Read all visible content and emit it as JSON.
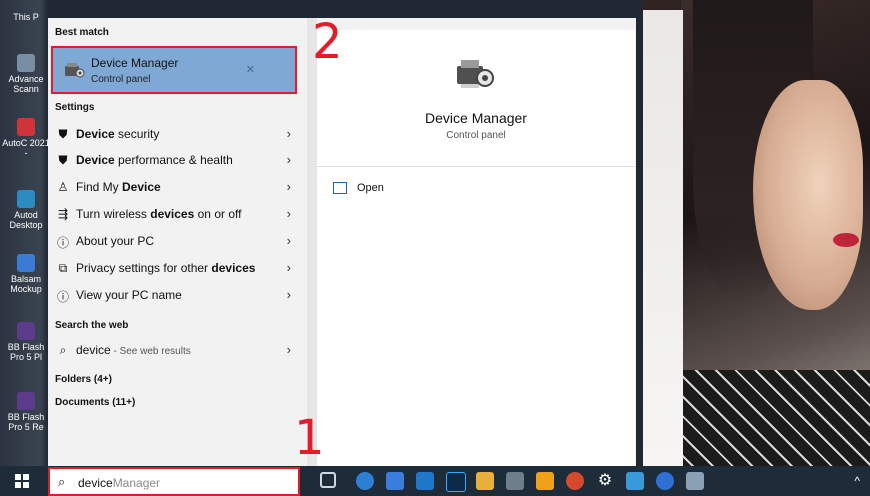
{
  "desktop": {
    "icons": [
      {
        "label": "This P",
        "color": "#4a7fb5"
      },
      {
        "label": "Advance Scann",
        "color": "#7a8ea3"
      },
      {
        "label": "AutoC 2021 -",
        "color": "#d13438"
      },
      {
        "label": "Autod Desktop",
        "color": "#2b8cc4"
      },
      {
        "label": "Balsam Mockup",
        "color": "#3a7bd5"
      },
      {
        "label": "BB Flash Pro 5 Pl",
        "color": "#5c3b8c"
      },
      {
        "label": "BB Flash Pro 5 Re",
        "color": "#5c3b8c"
      }
    ]
  },
  "start_menu": {
    "best_match_title": "Best match",
    "best_match": {
      "title": "Device Manager",
      "subtitle": "Control panel"
    },
    "settings_title": "Settings",
    "settings": [
      {
        "icon": "shield-icon",
        "glyph": "⛊",
        "pre": "",
        "bold": "Device",
        "post": " security"
      },
      {
        "icon": "shield-icon",
        "glyph": "⛊",
        "pre": "",
        "bold": "Device",
        "post": " performance & health"
      },
      {
        "icon": "person-icon",
        "glyph": "♙",
        "pre": "Find My ",
        "bold": "Device",
        "post": ""
      },
      {
        "icon": "wireless-icon",
        "glyph": "⇶",
        "pre": "Turn wireless ",
        "bold": "devices",
        "post": " on or off"
      },
      {
        "icon": "info-icon",
        "glyph": "ⓘ",
        "pre": "About your PC",
        "bold": "",
        "post": ""
      },
      {
        "icon": "privacy-icon",
        "glyph": "⧉",
        "pre": "Privacy settings for other ",
        "bold": "devices",
        "post": ""
      },
      {
        "icon": "info-icon",
        "glyph": "ⓘ",
        "pre": "View your PC name",
        "bold": "",
        "post": ""
      }
    ],
    "web_title": "Search the web",
    "web_result": {
      "bold": "device",
      "suffix": " - See web results"
    },
    "folders": "Folders (4+)",
    "documents": "Documents (11+)"
  },
  "preview": {
    "title": "Device Manager",
    "subtitle": "Control panel",
    "open_label": "Open"
  },
  "annotations": {
    "step1": "1",
    "step2": "2"
  },
  "taskbar": {
    "search_typed": "device",
    "search_ghost": "Manager",
    "tray": "^"
  },
  "colors": {
    "highlight_border": "#e01d28",
    "selected_bg": "#7fa9d4",
    "taskbar_bg": "#1e2b38"
  }
}
